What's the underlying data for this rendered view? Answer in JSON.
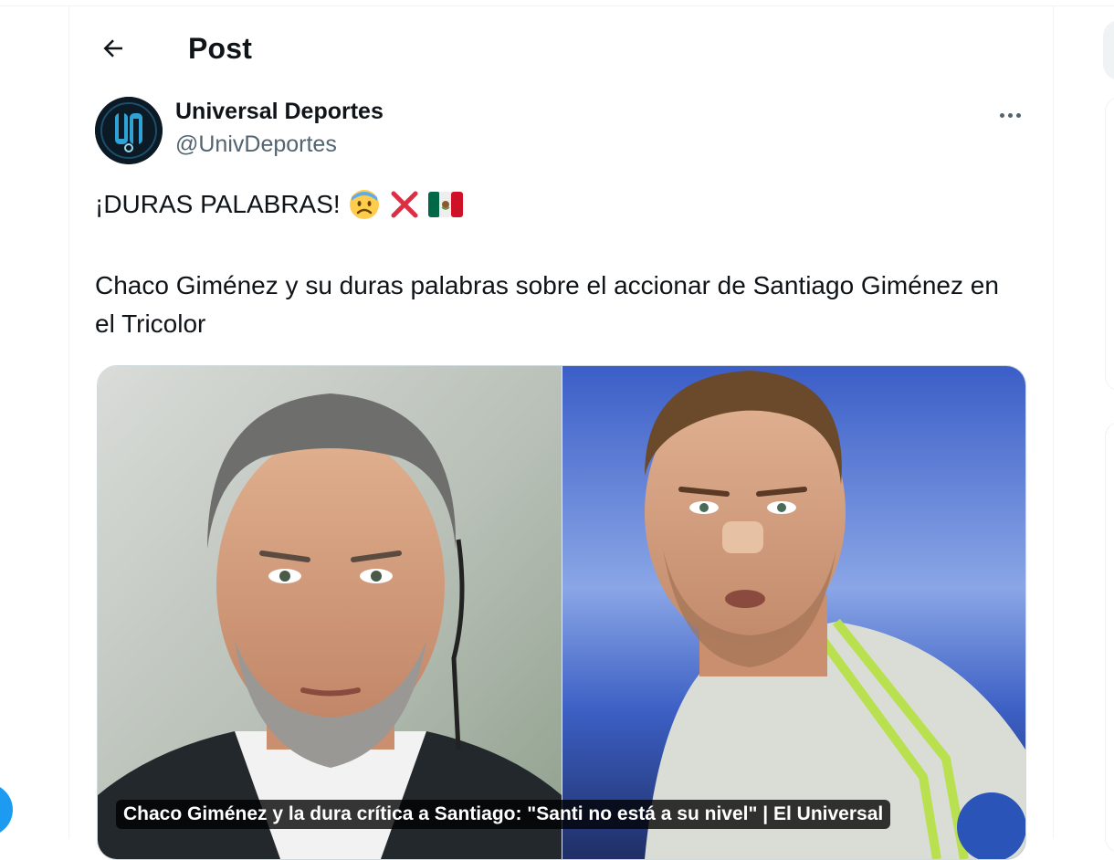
{
  "header": {
    "title": "Post"
  },
  "post": {
    "author_name": "Universal Deportes",
    "author_handle": "@UnivDeportes",
    "headline": "¡DURAS PALABRAS!",
    "headline_emojis": [
      "anxious-face-icon",
      "cross-mark-icon",
      "mexico-flag-icon"
    ],
    "body": "Chaco Giménez y su duras palabras sobre el accionar de Santiago Giménez en el Tricolor",
    "media_caption": "Chaco Giménez y la dura crítica a Santiago: \"Santi no está a su nivel\" | El Universal"
  },
  "colors": {
    "text": "#0f1419",
    "secondary": "#536471",
    "accent": "#1d9bf0",
    "border": "#cfd9de"
  }
}
